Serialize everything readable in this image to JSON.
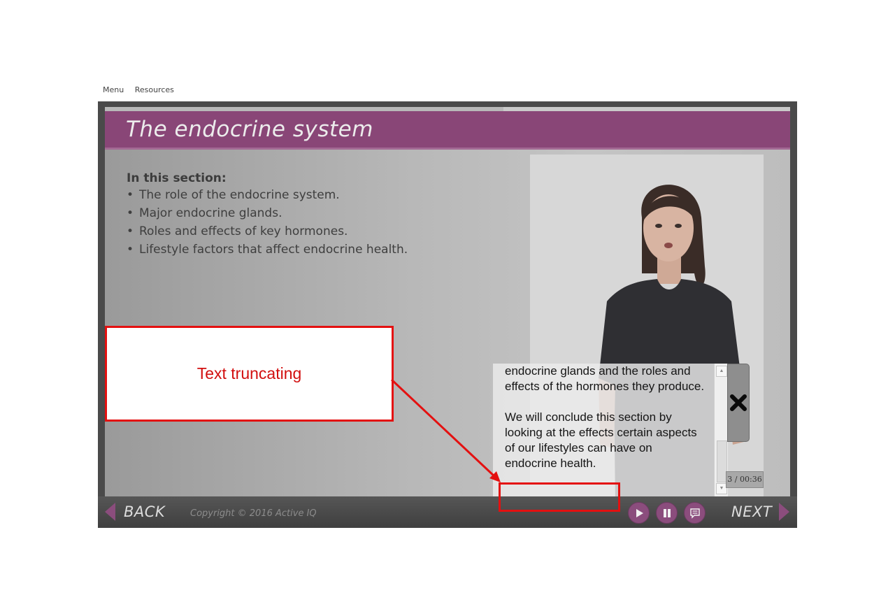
{
  "top_nav": {
    "menu": "Menu",
    "resources": "Resources"
  },
  "slide": {
    "title": "The endocrine system",
    "section_heading": "In this section:",
    "bullets": [
      "The role of the endocrine system.",
      "Major endocrine glands.",
      "Roles and effects of key hormones.",
      "Lifestyle factors that affect endocrine health."
    ]
  },
  "transcript": {
    "paragraph_1": "endocrine glands and the roles and effects of the hormones they produce.",
    "paragraph_2": "We will conclude this section by looking at the effects certain aspects of our lifestyles can have on endocrine health."
  },
  "video": {
    "time_display": "3 / 00:36"
  },
  "annotation": {
    "label": "Text truncating"
  },
  "footer": {
    "back_label": "BACK",
    "next_label": "NEXT",
    "copyright": "Copyright © 2016 Active IQ"
  },
  "icons": {
    "close": "close-x-icon",
    "play": "play-icon",
    "pause": "pause-icon",
    "transcript": "speech-bubble-icon"
  },
  "colors": {
    "brand_purple": "#894677",
    "annotation_red": "#e41010"
  }
}
